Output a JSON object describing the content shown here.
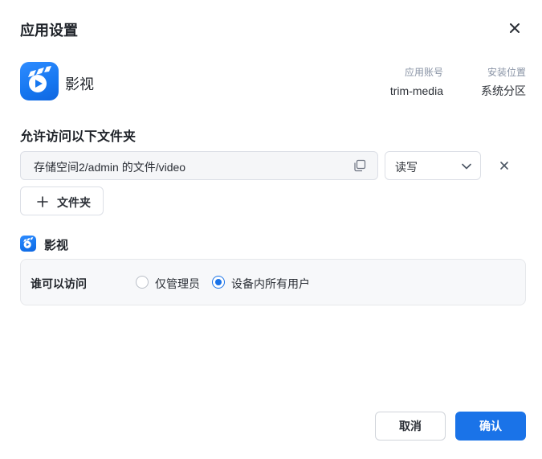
{
  "dialog": {
    "title": "应用设置",
    "close_icon": "close-icon"
  },
  "app": {
    "name": "影视",
    "icon": "film-app-icon",
    "account_label": "应用账号",
    "account_value": "trim-media",
    "location_label": "安装位置",
    "location_value": "系统分区"
  },
  "folders": {
    "section_title": "允许访问以下文件夹",
    "items": [
      {
        "path": "存储空间2/admin 的文件/video",
        "permission": "读写",
        "copy_icon": "copy-icon",
        "remove_icon": "close-icon"
      }
    ],
    "add_button_label": "文件夹"
  },
  "app_section": {
    "name": "影视",
    "access_label": "谁可以访问",
    "options": [
      {
        "label": "仅管理员",
        "checked": false
      },
      {
        "label": "设备内所有用户",
        "checked": true
      }
    ]
  },
  "footer": {
    "cancel_label": "取消",
    "confirm_label": "确认"
  },
  "colors": {
    "accent": "#1a73e8",
    "app_icon": "#1677f0"
  }
}
